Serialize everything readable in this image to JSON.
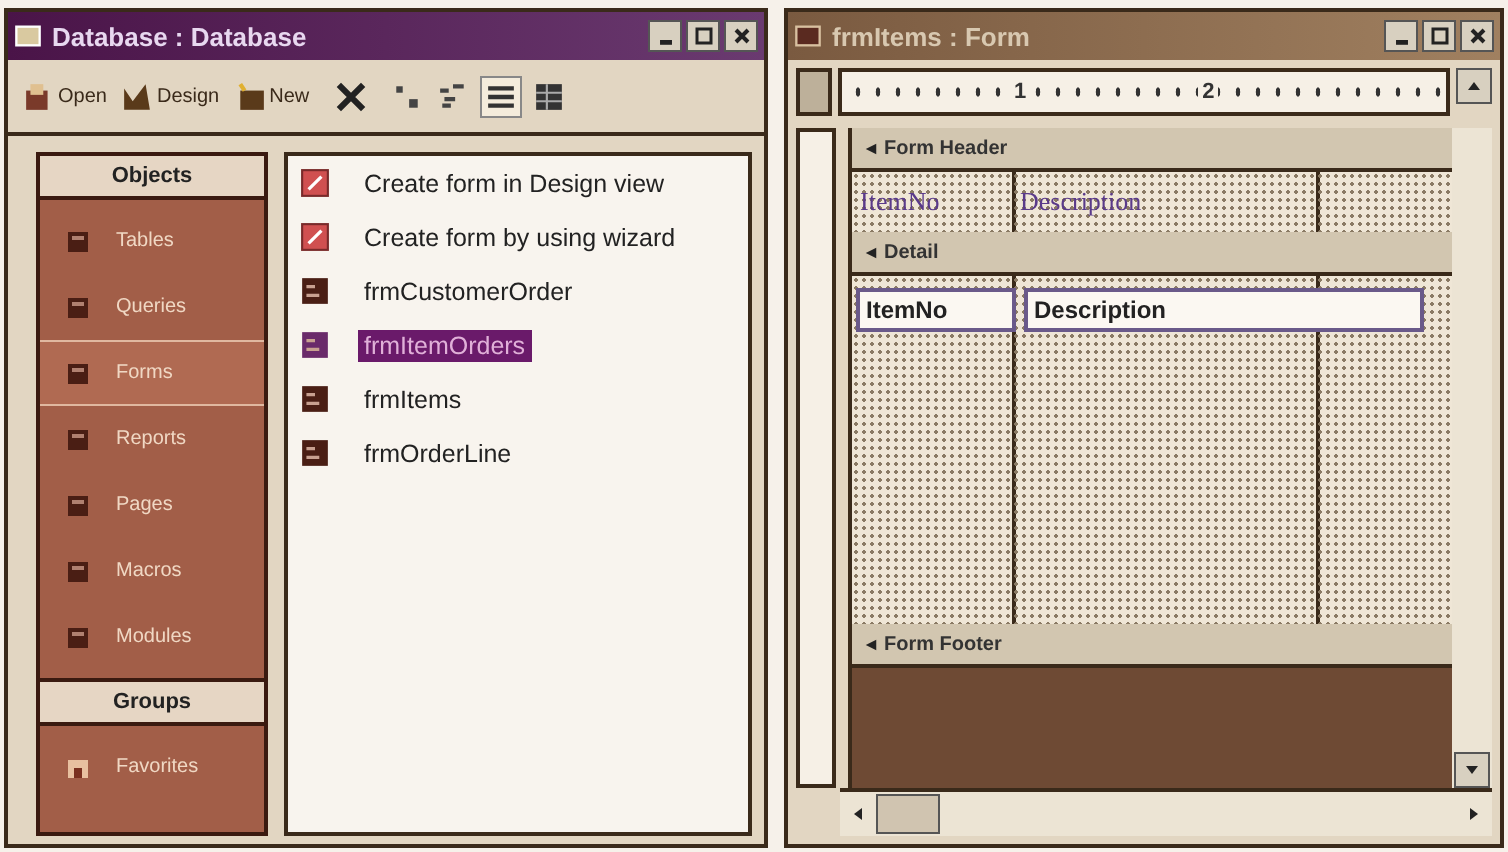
{
  "database_window": {
    "title": "Database : Database",
    "toolbar": [
      {
        "kind": "open",
        "label": "Open"
      },
      {
        "kind": "design",
        "label": "Design"
      },
      {
        "kind": "new",
        "label": "New"
      },
      {
        "kind": "delete"
      },
      {
        "kind": "large-icons"
      },
      {
        "kind": "small-icons"
      },
      {
        "kind": "list",
        "selected": true
      },
      {
        "kind": "details",
        "selected": false
      }
    ],
    "objects_header": "Objects",
    "objects": [
      {
        "label": "Tables",
        "selected": false
      },
      {
        "label": "Queries",
        "selected": false
      },
      {
        "label": "Forms",
        "selected": true
      },
      {
        "label": "Reports",
        "selected": false
      },
      {
        "label": "Pages",
        "selected": false
      },
      {
        "label": "Macros",
        "selected": false
      },
      {
        "label": "Modules",
        "selected": false
      }
    ],
    "groups_header": "Groups",
    "groups": [
      {
        "label": "Favorites"
      }
    ],
    "items": [
      {
        "kind": "shortcut",
        "label": "Create form in Design view",
        "selected": false
      },
      {
        "kind": "shortcut",
        "label": "Create form by using wizard",
        "selected": false
      },
      {
        "kind": "form",
        "label": "frmCustomerOrder",
        "selected": false
      },
      {
        "kind": "form",
        "label": "frmItemOrders",
        "selected": true
      },
      {
        "kind": "form",
        "label": "frmItems",
        "selected": false
      },
      {
        "kind": "form",
        "label": "frmOrderLine",
        "selected": false
      }
    ]
  },
  "form_window": {
    "title": "frmItems : Form",
    "ruler": [
      "1",
      "2"
    ],
    "form_header": {
      "title": "Form Header",
      "labels": [
        "ItemNo",
        "Description"
      ]
    },
    "detail": {
      "title": "Detail",
      "fields": [
        "ItemNo",
        "Description"
      ]
    },
    "form_footer": {
      "title": "Form Footer"
    }
  }
}
